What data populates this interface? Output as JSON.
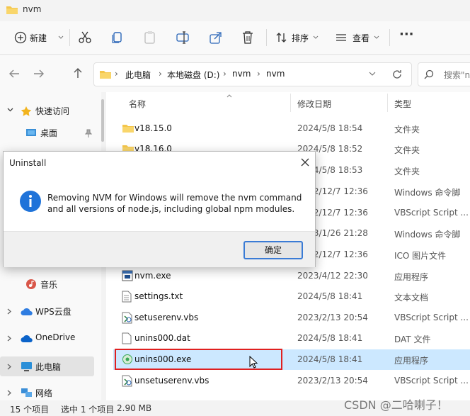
{
  "window": {
    "title": "nvm"
  },
  "toolbar": {
    "new_label": "新建",
    "sort_label": "排序",
    "view_label": "查看",
    "more_label": "···"
  },
  "address": {
    "crumbs": [
      "此电脑",
      "本地磁盘 (D:)",
      "nvm",
      "nvm"
    ],
    "search_placeholder": "搜索\"n"
  },
  "nav": {
    "quick_access": "快速访问",
    "desktop": "桌面",
    "music": "音乐",
    "wps": "WPS云盘",
    "onedrive": "OneDrive",
    "this_pc": "此电脑",
    "network": "网络"
  },
  "columns": {
    "name": "名称",
    "date": "修改日期",
    "type": "类型"
  },
  "files": [
    {
      "name": "v18.15.0",
      "date": "2024/5/8 18:54",
      "type": "文件夹",
      "icon": "folder"
    },
    {
      "name": "v18.16.0",
      "date": "2024/5/8 18:52",
      "type": "文件夹",
      "icon": "folder"
    },
    {
      "name": "",
      "date": "2024/5/8 18:53",
      "type": "文件夹",
      "icon": "folder"
    },
    {
      "name": "",
      "date": "2022/12/7 12:36",
      "type": "Windows 命令脚",
      "icon": "none"
    },
    {
      "name": "",
      "date": "2022/12/7 12:36",
      "type": "VBScript Script ...",
      "icon": "none"
    },
    {
      "name": "",
      "date": "2023/1/26 21:28",
      "type": "Windows 命令脚",
      "icon": "none"
    },
    {
      "name": "",
      "date": "2022/12/7 12:36",
      "type": "ICO 图片文件",
      "icon": "none"
    },
    {
      "name": "nvm.exe",
      "date": "2023/4/12 22:30",
      "type": "应用程序",
      "icon": "exe"
    },
    {
      "name": "settings.txt",
      "date": "2024/5/8 18:41",
      "type": "文本文档",
      "icon": "txt"
    },
    {
      "name": "setuserenv.vbs",
      "date": "2023/2/13 20:54",
      "type": "VBScript Script ...",
      "icon": "vbs"
    },
    {
      "name": "unins000.dat",
      "date": "2024/5/8 18:41",
      "type": "DAT 文件",
      "icon": "dat"
    },
    {
      "name": "unins000.exe",
      "date": "2024/5/8 18:41",
      "type": "应用程序",
      "icon": "setup"
    },
    {
      "name": "unsetuserenv.vbs",
      "date": "2023/2/13 20:54",
      "type": "VBScript Script ...",
      "icon": "vbs"
    }
  ],
  "dialog": {
    "title": "Uninstall",
    "message": "Removing NVM for Windows will remove the nvm command and all versions of node.js, including global npm modules.",
    "ok_label": "确定"
  },
  "status": {
    "count": "15 个项目",
    "selected": "选中 1 个项目",
    "size": "2.90 MB"
  },
  "watermark": "CSDN @二哈喇子！"
}
